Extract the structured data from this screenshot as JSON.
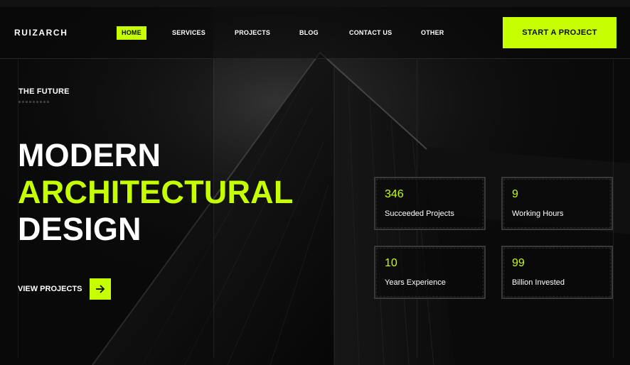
{
  "header": {
    "logo": "RUIZARCH",
    "nav": [
      {
        "label": "HOME",
        "active": true
      },
      {
        "label": "SERVICES",
        "active": false
      },
      {
        "label": "PROJECTS",
        "active": false
      },
      {
        "label": "BLOG",
        "active": false
      },
      {
        "label": "CONTACT US",
        "active": false
      },
      {
        "label": "OTHER",
        "active": false
      }
    ],
    "cta_label": "START A PROJECT"
  },
  "hero": {
    "eyebrow": "THE FUTURE",
    "headline_line1": "MODERN",
    "headline_line2": "ARCHITECTURAL",
    "headline_line3": "DESIGN",
    "view_projects_label": "VIEW PROJECTS",
    "arrow_icon": "arrow-right-icon"
  },
  "stats": [
    {
      "value": "346",
      "label": "Succeeded Projects"
    },
    {
      "value": "9",
      "label": "Working Hours"
    },
    {
      "value": "10",
      "label": "Years Experience"
    },
    {
      "value": "99",
      "label": "Billion Invested"
    }
  ],
  "colors": {
    "accent": "#c6ff00",
    "background": "#0a0a0a",
    "text": "#ffffff"
  }
}
